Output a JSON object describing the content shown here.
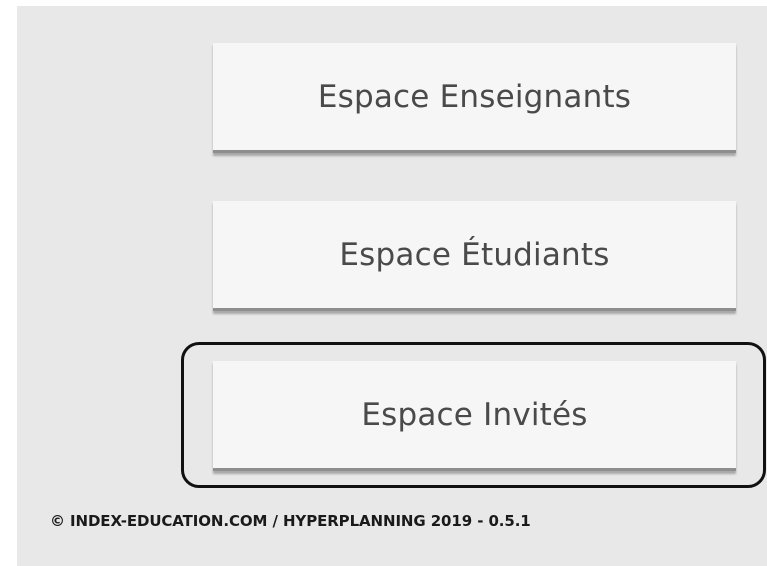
{
  "buttons": {
    "enseignants": "Espace Enseignants",
    "etudiants": "Espace Étudiants",
    "invites": "Espace Invités"
  },
  "footer": {
    "text": "© INDEX-EDUCATION.COM / HYPERPLANNING 2019 - 0.5.1"
  },
  "colors": {
    "panel_background": "#e8e8e8",
    "button_background": "#f6f6f6",
    "button_text": "#4a4a4a",
    "highlight_border": "#111111"
  }
}
